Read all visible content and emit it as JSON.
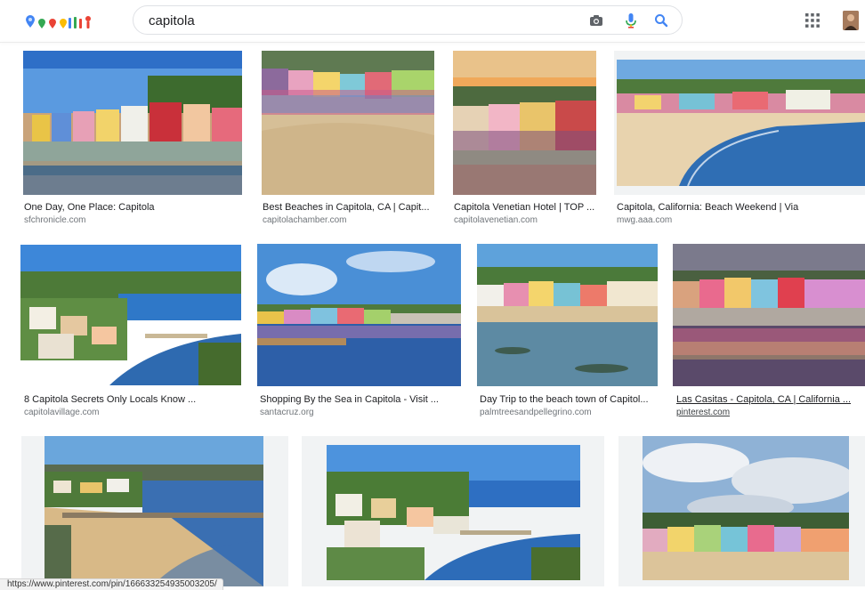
{
  "search": {
    "query": "capitola"
  },
  "header": {
    "doodle_icon": "google-doodle-logo",
    "camera_icon": "camera-icon",
    "mic_icon": "microphone-icon",
    "search_icon": "search-icon",
    "apps_icon": "apps-grid-icon"
  },
  "results": [
    {
      "title": "One Day, One Place: Capitola",
      "source": "sfchronicle.com"
    },
    {
      "title": "Best Beaches in Capitola, CA | Capit...",
      "source": "capitolachamber.com"
    },
    {
      "title": "Capitola Venetian Hotel | TOP ...",
      "source": "capitolavenetian.com"
    },
    {
      "title": "Capitola, California: Beach Weekend | Via",
      "source": "mwg.aaa.com"
    },
    {
      "title": "8 Capitola Secrets Only Locals Know ...",
      "source": "capitolavillage.com"
    },
    {
      "title": "Shopping By the Sea in Capitola - Visit ...",
      "source": "santacruz.org"
    },
    {
      "title": "Day Trip to the beach town of Capitol...",
      "source": "palmtreesandpellegrino.com"
    },
    {
      "title": "Las Casitas - Capitola, CA | California ...",
      "source": "pinterest.com"
    },
    {
      "title": "",
      "source": ""
    },
    {
      "title": "",
      "source": ""
    },
    {
      "title": "",
      "source": ""
    }
  ],
  "status_bar": {
    "url": "https://www.pinterest.com/pin/166633254935003205/"
  },
  "colors": {
    "sky": "#4a8fd6",
    "sea": "#3f7fc4",
    "sand": "#dcc49a",
    "accent_blue": "#4285f4",
    "mic_yellow": "#fbbc05"
  }
}
